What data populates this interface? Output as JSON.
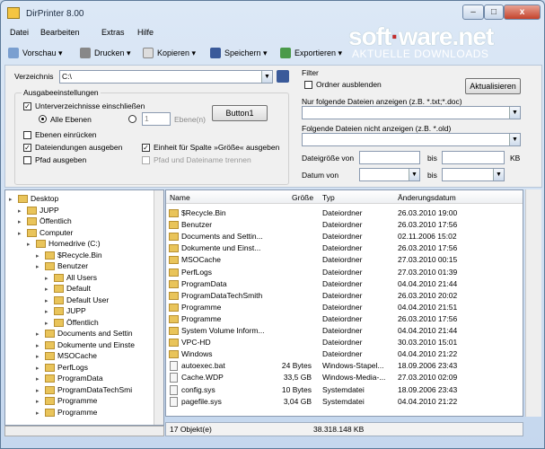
{
  "window": {
    "title": "DirPrinter 8.00",
    "btn_min": "–",
    "btn_max": "□",
    "btn_close": "x"
  },
  "menu": [
    "Datei",
    "Bearbeiten",
    "Extras",
    "Hilfe"
  ],
  "toolbar": {
    "vorschau": "Vorschau",
    "drucken": "Drucken",
    "kopieren": "Kopieren",
    "speichern": "Speichern",
    "exportieren": "Exportieren"
  },
  "logo": {
    "part1": "soft",
    "part2": "ware",
    "part3": ".net",
    "tagline": "AKTUELLE DOWNLOADS"
  },
  "settings": {
    "verzeichnis_label": "Verzeichnis",
    "verzeichnis_value": "C:\\",
    "ausgabe_label": "Ausgabeeinstellungen",
    "unterverzeichnisse": "Unterverzeichnisse einschließen",
    "alle_ebenen": "Alle Ebenen",
    "ebenen_value": "1",
    "ebenen_label": "Ebene(n)",
    "button1": "Button1",
    "ebenen_einruecken": "Ebenen einrücken",
    "dateiendungen": "Dateiendungen ausgeben",
    "einheit": "Einheit für Spalte »Größe« ausgeben",
    "pfad": "Pfad ausgeben",
    "pfad_dateiname": "Pfad und Dateiname trennen"
  },
  "filter": {
    "label": "Filter",
    "ordner": "Ordner ausblenden",
    "aktualisieren": "Aktualisieren",
    "nur_folgende": "Nur folgende Dateien anzeigen (z.B. *.txt;*.doc)",
    "nicht_anzeigen": "Folgende Dateien nicht anzeigen (z.B. *.old)",
    "groesse_von": "Dateigröße von",
    "bis1": "bis",
    "kb": "KB",
    "datum_von": "Datum von",
    "bis2": "bis"
  },
  "tree": [
    {
      "label": "Desktop",
      "lvl": 0
    },
    {
      "label": "JUPP",
      "lvl": 1
    },
    {
      "label": "Öffentlich",
      "lvl": 1
    },
    {
      "label": "Computer",
      "lvl": 1
    },
    {
      "label": "Homedrive (C:)",
      "lvl": 2
    },
    {
      "label": "$Recycle.Bin",
      "lvl": 3
    },
    {
      "label": "Benutzer",
      "lvl": 3
    },
    {
      "label": "All Users",
      "lvl": 4
    },
    {
      "label": "Default",
      "lvl": 4
    },
    {
      "label": "Default User",
      "lvl": 4
    },
    {
      "label": "JUPP",
      "lvl": 4
    },
    {
      "label": "Öffentlich",
      "lvl": 4
    },
    {
      "label": "Documents and Settin",
      "lvl": 3
    },
    {
      "label": "Dokumente und Einste",
      "lvl": 3
    },
    {
      "label": "MSOCache",
      "lvl": 3
    },
    {
      "label": "PerfLogs",
      "lvl": 3
    },
    {
      "label": "ProgramData",
      "lvl": 3
    },
    {
      "label": "ProgramDataTechSmi",
      "lvl": 3
    },
    {
      "label": "Programme",
      "lvl": 3
    },
    {
      "label": "Programme",
      "lvl": 3
    }
  ],
  "list": {
    "headers": {
      "name": "Name",
      "size": "Größe",
      "type": "Typ",
      "date": "Änderungsdatum"
    },
    "rows": [
      {
        "name": "$Recycle.Bin",
        "size": "",
        "type": "Dateiordner",
        "date": "26.03.2010 19:00",
        "kind": "folder"
      },
      {
        "name": "Benutzer",
        "size": "",
        "type": "Dateiordner",
        "date": "26.03.2010 17:56",
        "kind": "folder"
      },
      {
        "name": "Documents and Settin...",
        "size": "",
        "type": "Dateiordner",
        "date": "02.11.2006 15:02",
        "kind": "folder"
      },
      {
        "name": "Dokumente und Einst...",
        "size": "",
        "type": "Dateiordner",
        "date": "26.03.2010 17:56",
        "kind": "folder"
      },
      {
        "name": "MSOCache",
        "size": "",
        "type": "Dateiordner",
        "date": "27.03.2010 00:15",
        "kind": "folder"
      },
      {
        "name": "PerfLogs",
        "size": "",
        "type": "Dateiordner",
        "date": "27.03.2010 01:39",
        "kind": "folder"
      },
      {
        "name": "ProgramData",
        "size": "",
        "type": "Dateiordner",
        "date": "04.04.2010 21:44",
        "kind": "folder"
      },
      {
        "name": "ProgramDataTechSmith",
        "size": "",
        "type": "Dateiordner",
        "date": "26.03.2010 20:02",
        "kind": "folder"
      },
      {
        "name": "Programme",
        "size": "",
        "type": "Dateiordner",
        "date": "04.04.2010 21:51",
        "kind": "folder"
      },
      {
        "name": "Programme",
        "size": "",
        "type": "Dateiordner",
        "date": "26.03.2010 17:56",
        "kind": "folder"
      },
      {
        "name": "System Volume Inform...",
        "size": "",
        "type": "Dateiordner",
        "date": "04.04.2010 21:44",
        "kind": "folder"
      },
      {
        "name": "VPC-HD",
        "size": "",
        "type": "Dateiordner",
        "date": "30.03.2010 15:01",
        "kind": "folder"
      },
      {
        "name": "Windows",
        "size": "",
        "type": "Dateiordner",
        "date": "04.04.2010 21:22",
        "kind": "folder"
      },
      {
        "name": "autoexec.bat",
        "size": "24 Bytes",
        "type": "Windows-Stapel...",
        "date": "18.09.2006 23:43",
        "kind": "file"
      },
      {
        "name": "Cache.WDP",
        "size": "33,5 GB",
        "type": "Windows-Media-...",
        "date": "27.03.2010 02:09",
        "kind": "file"
      },
      {
        "name": "config.sys",
        "size": "10 Bytes",
        "type": "Systemdatei",
        "date": "18.09.2006 23:43",
        "kind": "file"
      },
      {
        "name": "pagefile.sys",
        "size": "3,04 GB",
        "type": "Systemdatei",
        "date": "04.04.2010 21:22",
        "kind": "file"
      }
    ]
  },
  "status": {
    "count": "17 Objekt(e)",
    "total": "38.318.148 KB"
  }
}
